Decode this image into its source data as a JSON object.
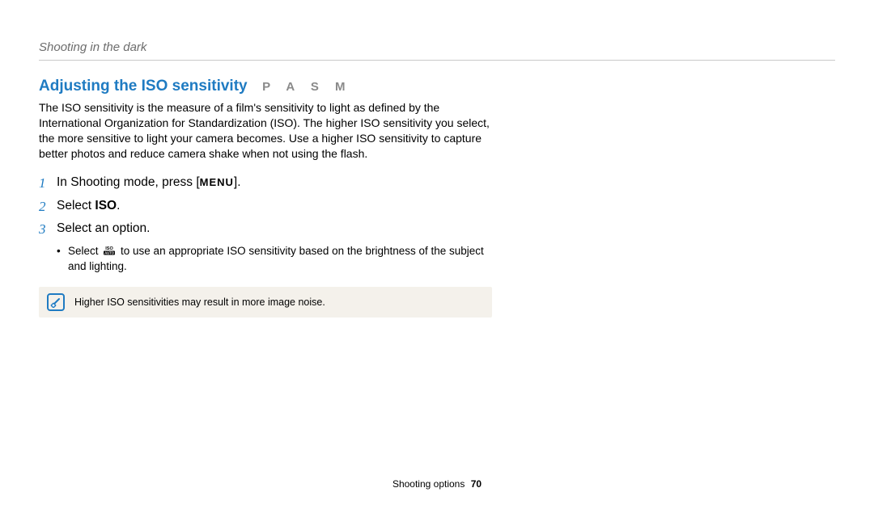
{
  "header": {
    "breadcrumb": "Shooting in the dark"
  },
  "section": {
    "title": "Adjusting the ISO sensitivity",
    "modes": "P A S M",
    "intro": "The ISO sensitivity is the measure of a film's sensitivity to light as defined by the International Organization for Standardization (ISO). The higher ISO sensitivity you select, the more sensitive to light your camera becomes. Use a higher ISO sensitivity to capture better photos and reduce camera shake when not using the flash."
  },
  "steps": [
    {
      "num": "1",
      "prefix": "In Shooting mode, press [",
      "menu": "MENU",
      "suffix": "]."
    },
    {
      "num": "2",
      "prefix": "Select ",
      "bold": "ISO",
      "suffix": "."
    },
    {
      "num": "3",
      "text": "Select an option."
    }
  ],
  "bullet": {
    "prefix": "Select ",
    "icon": "iso-auto-icon",
    "suffix": " to use an appropriate ISO sensitivity based on the brightness of the subject and lighting."
  },
  "note": {
    "text": "Higher ISO sensitivities may result in more image noise."
  },
  "footer": {
    "section": "Shooting options",
    "page": "70"
  }
}
